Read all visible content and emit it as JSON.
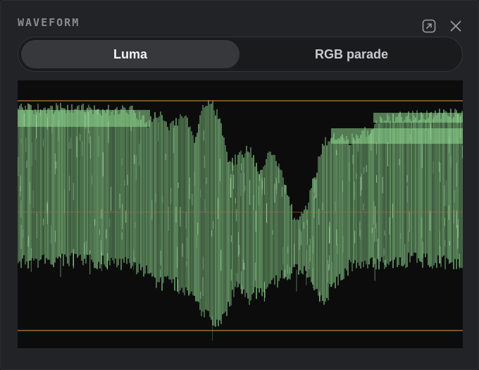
{
  "panel": {
    "title": "WAVEFORM"
  },
  "header_icons": [
    {
      "name": "popout-icon"
    },
    {
      "name": "close-icon"
    }
  ],
  "tabs": [
    {
      "label": "Luma",
      "active": true
    },
    {
      "label": "RGB parade",
      "active": false
    }
  ],
  "colors": {
    "waveform": "#8fd88f",
    "guide_line": "#b0743e",
    "scope_bg": "#0c0c0d"
  }
}
